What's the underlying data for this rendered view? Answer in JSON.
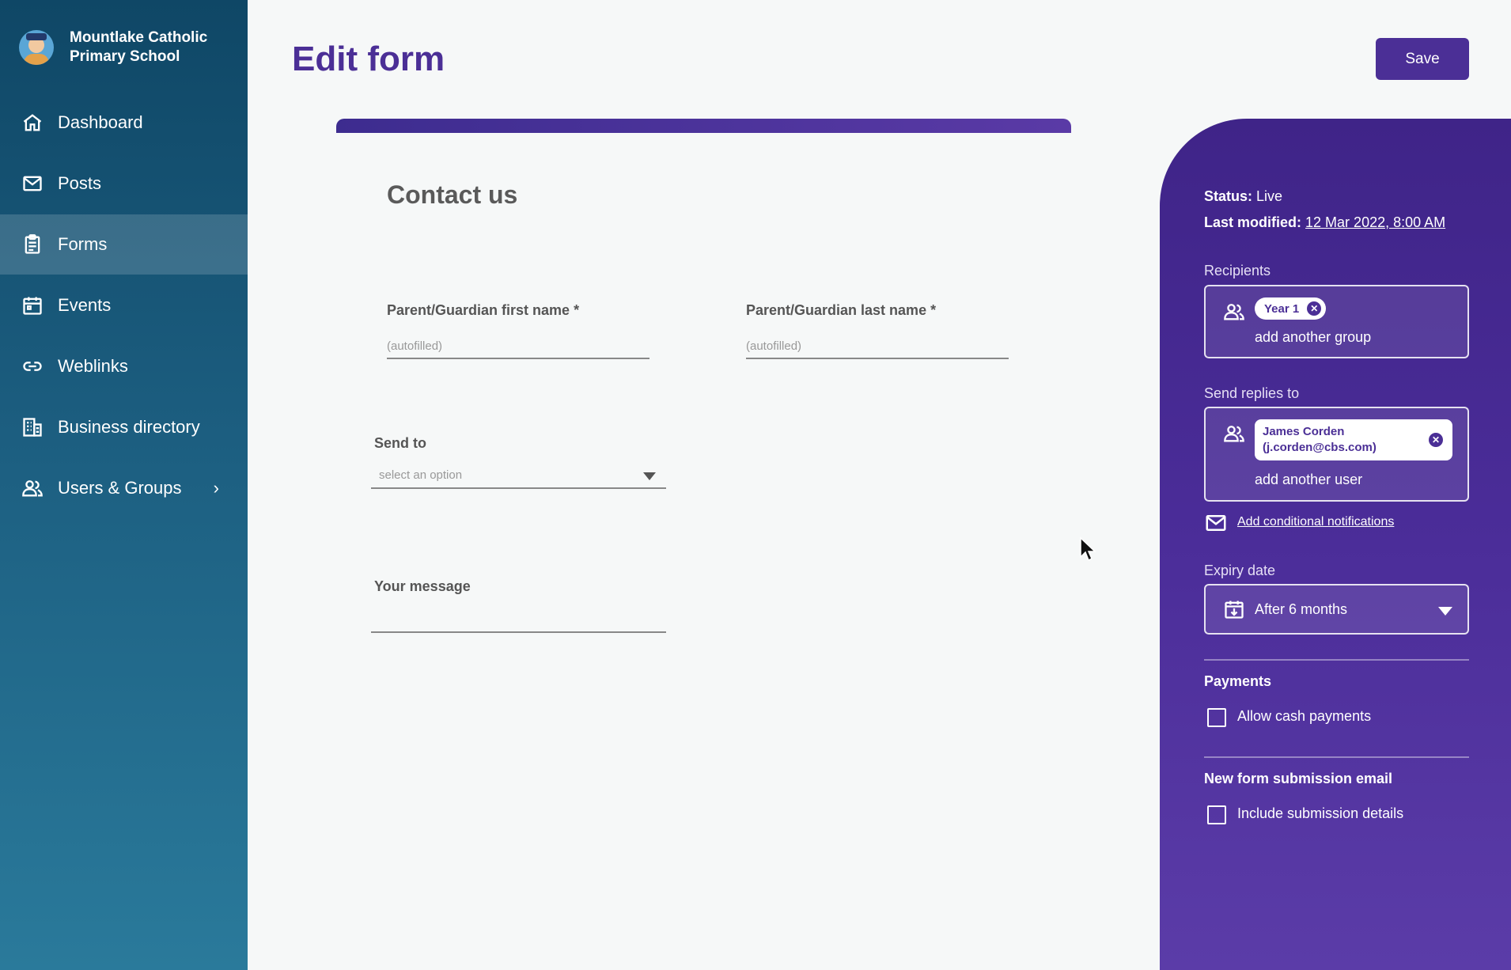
{
  "sidebar": {
    "school_name": "Mountlake Catholic Primary School",
    "items": [
      {
        "label": "Dashboard",
        "icon": "home-icon"
      },
      {
        "label": "Posts",
        "icon": "mail-icon"
      },
      {
        "label": "Forms",
        "icon": "clipboard-icon",
        "active": true
      },
      {
        "label": "Events",
        "icon": "calendar-icon"
      },
      {
        "label": "Weblinks",
        "icon": "link-icon"
      },
      {
        "label": "Business directory",
        "icon": "building-icon"
      },
      {
        "label": "Users & Groups",
        "icon": "users-icon",
        "chevron": "›"
      }
    ]
  },
  "header": {
    "title": "Edit form",
    "save_label": "Save"
  },
  "form": {
    "heading": "Contact us",
    "first_name": {
      "label": "Parent/Guardian first name *",
      "placeholder": "(autofilled)"
    },
    "last_name": {
      "label": "Parent/Guardian last name *",
      "placeholder": "(autofilled)"
    },
    "send_to": {
      "label": "Send to",
      "placeholder": "select an option"
    },
    "message": {
      "label": "Your message"
    }
  },
  "panel": {
    "status_label": "Status:",
    "status_value": "Live",
    "modified_label": "Last modified:",
    "modified_value": "12 Mar 2022, 8:00 AM",
    "recipients_label": "Recipients",
    "recipient_chip": "Year 1",
    "add_group": "add another group",
    "replies_label": "Send replies to",
    "reply_chip_line1": "James Corden",
    "reply_chip_line2": "(j.corden@cbs.com)",
    "add_user": "add another user",
    "conditional_link": "Add conditional notifications",
    "expiry_label": "Expiry date",
    "expiry_value": "After 6 months",
    "payments_label": "Payments",
    "cash_label": "Allow cash payments",
    "email_label": "New form submission email",
    "include_label": "Include submission details"
  },
  "colors": {
    "accent": "#4b2f96",
    "sidebar_top": "#0f4766",
    "sidebar_bottom": "#2a7a9b"
  }
}
